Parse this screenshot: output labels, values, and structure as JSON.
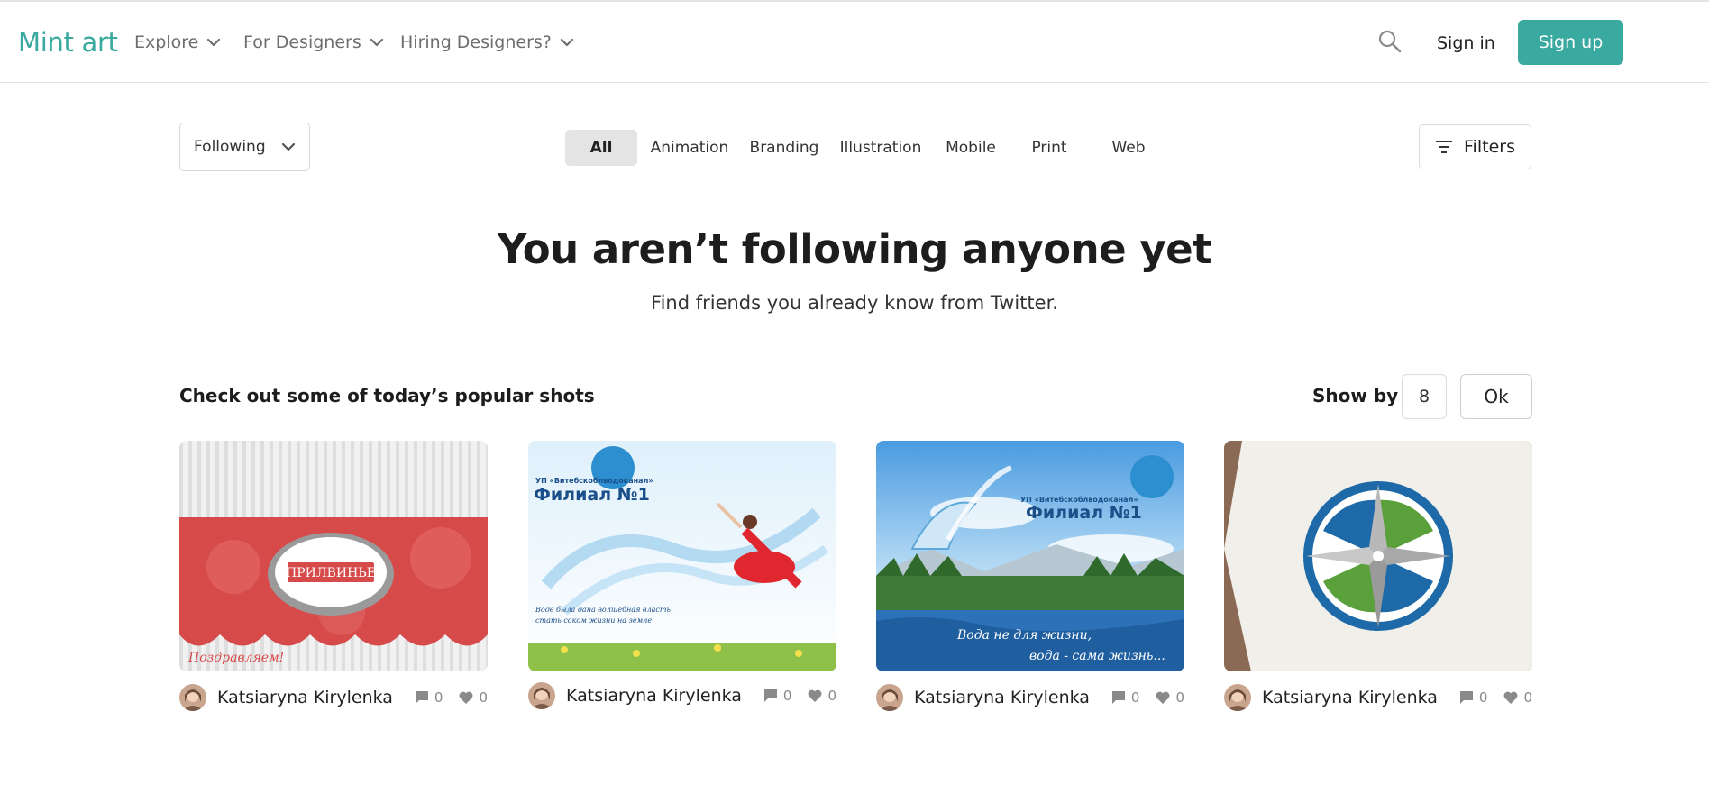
{
  "header": {
    "logo": "Mint art",
    "nav": [
      {
        "label": "Explore"
      },
      {
        "label": "For Designers"
      },
      {
        "label": "Hiring Designers?"
      }
    ],
    "sign_in": "Sign in",
    "sign_up": "Sign up",
    "accent_color": "#3aa99f"
  },
  "filters": {
    "feed_select": "Following",
    "categories": [
      "All",
      "Animation",
      "Branding",
      "Illustration",
      "Mobile",
      "Print",
      "Web"
    ],
    "active_category": "All",
    "filters_label": "Filters"
  },
  "empty_state": {
    "title": "You aren’t following anyone yet",
    "subtitle": "Find friends you already know from Twitter."
  },
  "popular": {
    "title": "Check out some of today’s popular shots",
    "show_by_label": "Show by",
    "show_by_value": "8",
    "ok_label": "Ok",
    "shots": [
      {
        "author": "Katsiaryna Kirylenka",
        "comments": "0",
        "likes": "0",
        "image": "red-floral-greeting-card"
      },
      {
        "author": "Katsiaryna Kirylenka",
        "comments": "0",
        "likes": "0",
        "image": "water-dancer-poster"
      },
      {
        "author": "Katsiaryna Kirylenka",
        "comments": "0",
        "likes": "0",
        "image": "water-dove-lake-poster"
      },
      {
        "author": "Katsiaryna Kirylenka",
        "comments": "0",
        "likes": "0",
        "image": "compass-logo-on-paper"
      }
    ]
  }
}
